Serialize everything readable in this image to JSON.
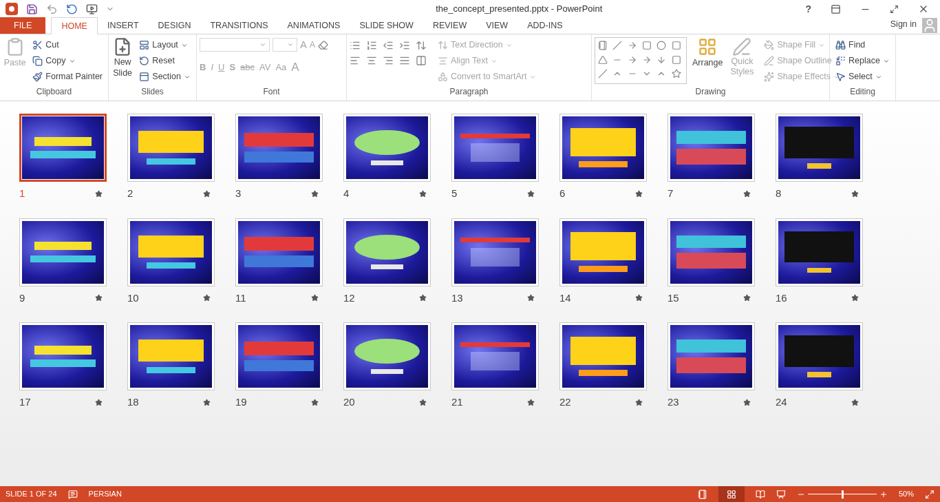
{
  "window": {
    "title": "the_concept_presented.pptx - PowerPoint",
    "help": "?"
  },
  "tabs": [
    {
      "label": "FILE",
      "kind": "file",
      "selected": false
    },
    {
      "label": "HOME",
      "kind": "tab",
      "selected": true
    },
    {
      "label": "INSERT",
      "kind": "tab",
      "selected": false
    },
    {
      "label": "DESIGN",
      "kind": "tab",
      "selected": false
    },
    {
      "label": "TRANSITIONS",
      "kind": "tab",
      "selected": false
    },
    {
      "label": "ANIMATIONS",
      "kind": "tab",
      "selected": false
    },
    {
      "label": "SLIDE SHOW",
      "kind": "tab",
      "selected": false
    },
    {
      "label": "REVIEW",
      "kind": "tab",
      "selected": false
    },
    {
      "label": "VIEW",
      "kind": "tab",
      "selected": false
    },
    {
      "label": "ADD-INS",
      "kind": "tab",
      "selected": false
    }
  ],
  "sign_in": "Sign in",
  "ribbon": {
    "clipboard": {
      "label": "Clipboard",
      "paste": {
        "label": "Paste",
        "disabled": true
      },
      "items": [
        {
          "label": "Cut",
          "disabled": false
        },
        {
          "label": "Copy",
          "disabled": false
        },
        {
          "label": "Format Painter",
          "disabled": false
        }
      ]
    },
    "slides": {
      "label": "Slides",
      "new_slide": "New Slide",
      "items": [
        {
          "label": "Layout",
          "disabled": false
        },
        {
          "label": "Reset",
          "disabled": false
        },
        {
          "label": "Section",
          "disabled": false
        }
      ]
    },
    "font": {
      "label": "Font",
      "size_buttons": [
        "A",
        "A"
      ],
      "format_buttons": [
        "B",
        "I",
        "U",
        "S",
        "abc",
        "AV",
        "Aa",
        "A"
      ],
      "disabled": true
    },
    "paragraph": {
      "label": "Paragraph",
      "items": [
        {
          "label": "Text Direction",
          "disabled": true
        },
        {
          "label": "Align Text",
          "disabled": true
        },
        {
          "label": "Convert to SmartArt",
          "disabled": true
        }
      ]
    },
    "drawing": {
      "label": "Drawing",
      "arrange": "Arrange",
      "quick_styles": {
        "label": "Quick Styles",
        "disabled": true
      },
      "items": [
        {
          "label": "Shape Fill",
          "disabled": true
        },
        {
          "label": "Shape Outline",
          "disabled": true
        },
        {
          "label": "Shape Effects",
          "disabled": true
        }
      ]
    },
    "editing": {
      "label": "Editing",
      "items": [
        {
          "label": "Find",
          "disabled": false
        },
        {
          "label": "Replace",
          "disabled": false
        },
        {
          "label": "Select",
          "disabled": false
        }
      ]
    }
  },
  "slides": [
    {
      "number": "1",
      "selected": true,
      "animated": true
    },
    {
      "number": "2",
      "selected": false,
      "animated": true
    },
    {
      "number": "3",
      "selected": false,
      "animated": true
    },
    {
      "number": "4",
      "selected": false,
      "animated": true
    },
    {
      "number": "5",
      "selected": false,
      "animated": true
    },
    {
      "number": "6",
      "selected": false,
      "animated": true
    },
    {
      "number": "7",
      "selected": false,
      "animated": true
    },
    {
      "number": "8",
      "selected": false,
      "animated": true
    },
    {
      "number": "9",
      "selected": false,
      "animated": true
    },
    {
      "number": "10",
      "selected": false,
      "animated": true
    },
    {
      "number": "11",
      "selected": false,
      "animated": true
    },
    {
      "number": "12",
      "selected": false,
      "animated": true
    },
    {
      "number": "13",
      "selected": false,
      "animated": true
    },
    {
      "number": "14",
      "selected": false,
      "animated": true
    },
    {
      "number": "15",
      "selected": false,
      "animated": true
    },
    {
      "number": "16",
      "selected": false,
      "animated": true
    },
    {
      "number": "17",
      "selected": false,
      "animated": true
    },
    {
      "number": "18",
      "selected": false,
      "animated": true
    },
    {
      "number": "19",
      "selected": false,
      "animated": true
    },
    {
      "number": "20",
      "selected": false,
      "animated": true
    },
    {
      "number": "21",
      "selected": false,
      "animated": true
    },
    {
      "number": "22",
      "selected": false,
      "animated": true
    },
    {
      "number": "23",
      "selected": false,
      "animated": true
    },
    {
      "number": "24",
      "selected": false,
      "animated": true
    }
  ],
  "status_bar": {
    "slide_indicator": "SLIDE 1 OF 24",
    "language": "PERSIAN",
    "zoom": "50%",
    "zoom_slider": {
      "level": 0.5
    }
  }
}
